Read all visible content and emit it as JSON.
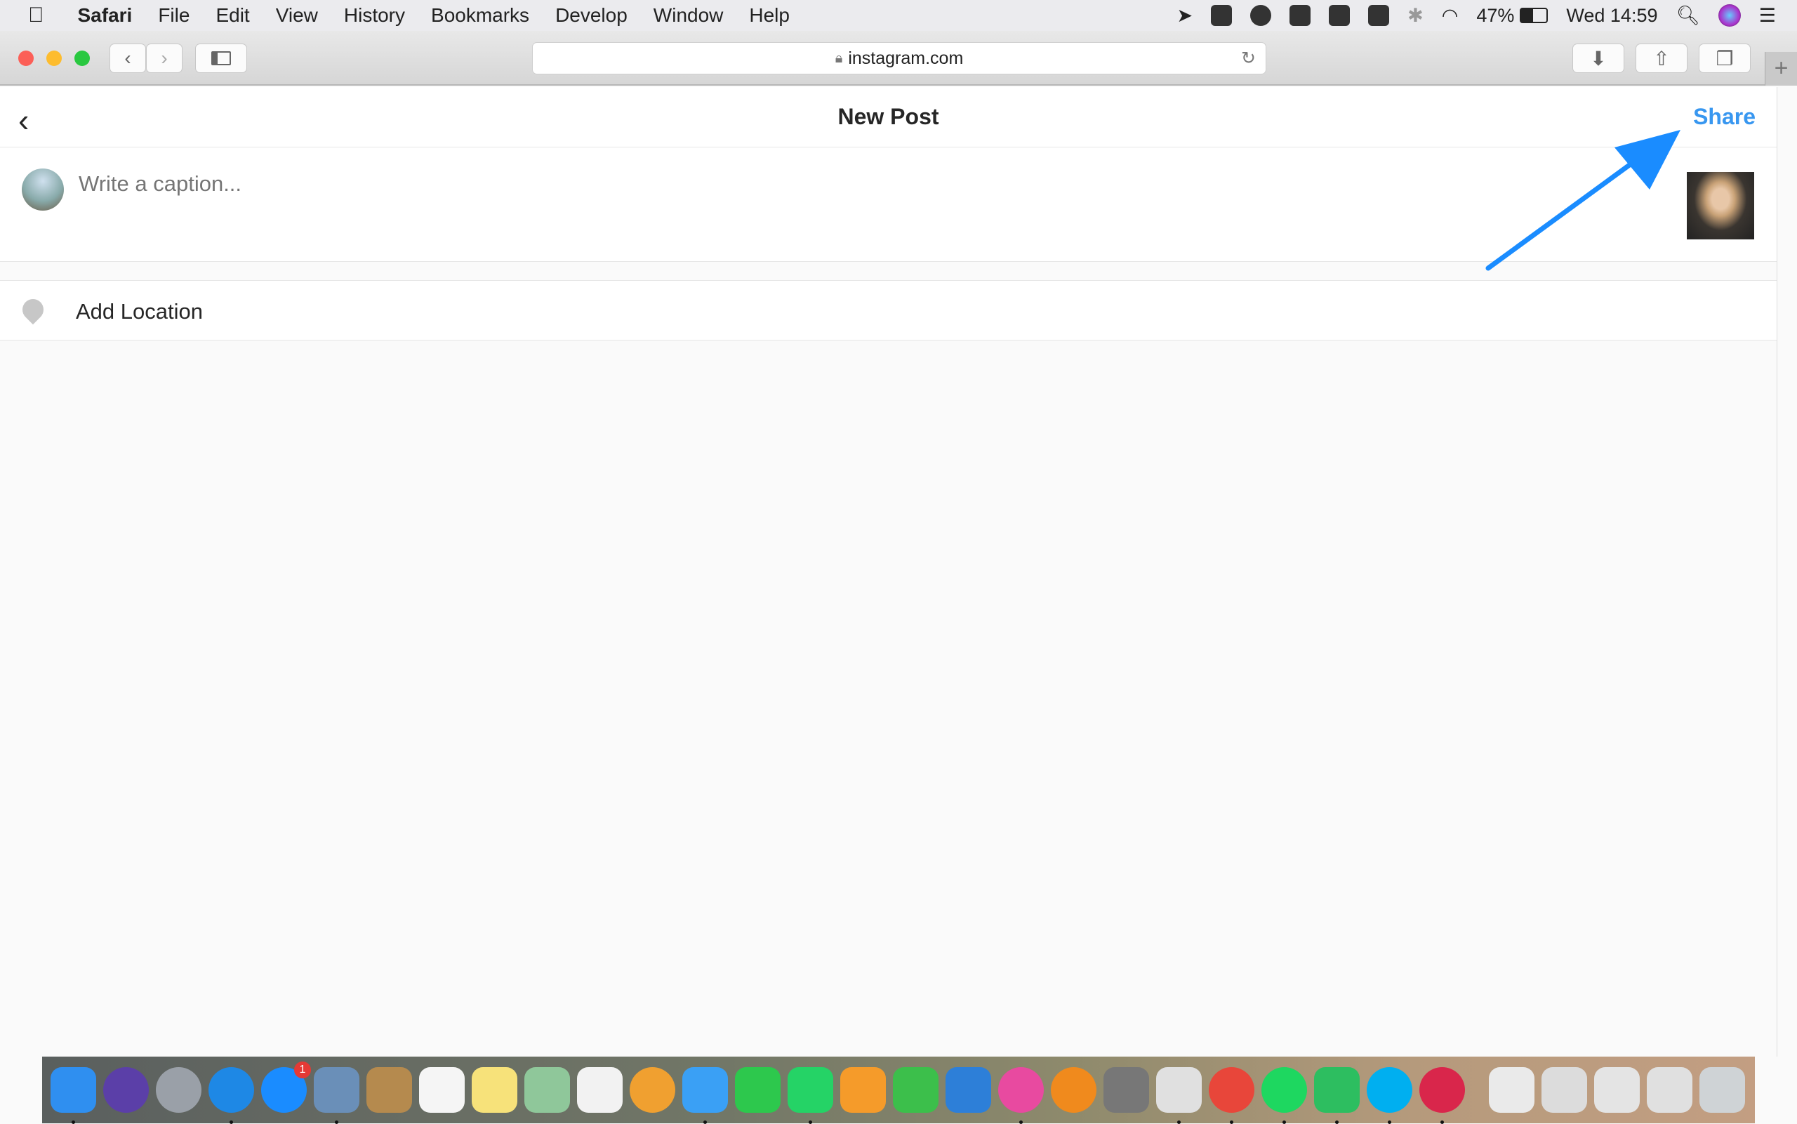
{
  "menubar": {
    "app": "Safari",
    "items": [
      "File",
      "Edit",
      "View",
      "History",
      "Bookmarks",
      "Develop",
      "Window",
      "Help"
    ],
    "battery": "47%",
    "clock": "Wed 14:59"
  },
  "browser": {
    "url": "instagram.com"
  },
  "post": {
    "title": "New Post",
    "share_label": "Share",
    "caption_placeholder": "Write a caption...",
    "location_label": "Add Location",
    "accent": "#3897f0",
    "arrow_color": "#1a8cff"
  },
  "dock": {
    "badge": "1",
    "apps": [
      {
        "name": "finder",
        "color": "#2f8ff0",
        "dot": true
      },
      {
        "name": "siri",
        "color": "#5b3fa8"
      },
      {
        "name": "launchpad",
        "color": "#9aa0a8"
      },
      {
        "name": "safari",
        "color": "#1e88e5",
        "dot": true
      },
      {
        "name": "app-store",
        "color": "#1a8cff",
        "badge": true
      },
      {
        "name": "preview",
        "color": "#6a8fb8",
        "dot": true
      },
      {
        "name": "contacts",
        "color": "#b58a4e"
      },
      {
        "name": "calendar",
        "color": "#f5f5f5"
      },
      {
        "name": "notes",
        "color": "#f7e27a"
      },
      {
        "name": "maps",
        "color": "#8fc79a"
      },
      {
        "name": "reminders",
        "color": "#f2f2f2"
      },
      {
        "name": "photos",
        "color": "#f0a030"
      },
      {
        "name": "messages",
        "color": "#3aa0f5",
        "dot": true
      },
      {
        "name": "facetime",
        "color": "#2dc84d"
      },
      {
        "name": "whatsapp",
        "color": "#25d366",
        "dot": true
      },
      {
        "name": "pages",
        "color": "#f59b2a"
      },
      {
        "name": "numbers",
        "color": "#3cbf4b"
      },
      {
        "name": "keynote",
        "color": "#2d7fd8"
      },
      {
        "name": "itunes",
        "color": "#e84aa0",
        "dot": true
      },
      {
        "name": "ibooks",
        "color": "#f08a1d"
      },
      {
        "name": "system-preferences",
        "color": "#777"
      },
      {
        "name": "slack",
        "color": "#e0e0e0",
        "dot": true
      },
      {
        "name": "chrome",
        "color": "#e8463a",
        "dot": true
      },
      {
        "name": "spotify",
        "color": "#1ed760",
        "dot": true
      },
      {
        "name": "evernote",
        "color": "#2dbe60",
        "dot": true
      },
      {
        "name": "skype",
        "color": "#00aff0",
        "dot": true
      },
      {
        "name": "airmail",
        "color": "#d9264b",
        "dot": true
      },
      {
        "name": "window-1",
        "color": "#eaeaea"
      },
      {
        "name": "window-2",
        "color": "#dcdcdc"
      },
      {
        "name": "window-3",
        "color": "#e4e4e4"
      },
      {
        "name": "window-4",
        "color": "#e0e0e0"
      },
      {
        "name": "trash",
        "color": "#cfd3d6"
      }
    ]
  }
}
